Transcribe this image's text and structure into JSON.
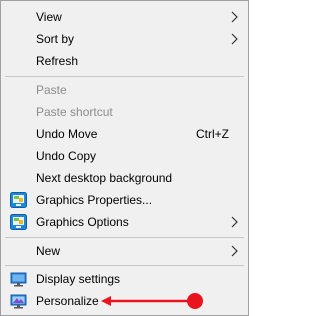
{
  "context_menu": {
    "view": {
      "label": "View",
      "icon": "chevron-right-icon"
    },
    "sort_by": {
      "label": "Sort by",
      "icon": "chevron-right-icon"
    },
    "refresh": {
      "label": "Refresh"
    },
    "paste": {
      "label": "Paste",
      "disabled": true
    },
    "paste_shortcut": {
      "label": "Paste shortcut",
      "disabled": true
    },
    "undo_move": {
      "label": "Undo Move",
      "shortcut": "Ctrl+Z"
    },
    "undo_copy": {
      "label": "Undo Copy"
    },
    "next_background": {
      "label": "Next desktop background"
    },
    "graphics_properties": {
      "label": "Graphics Properties...",
      "icon": "intel-graphics-icon"
    },
    "graphics_options": {
      "label": "Graphics Options",
      "icon": "intel-graphics-icon",
      "submenu_icon": "chevron-right-icon"
    },
    "new": {
      "label": "New",
      "icon": "chevron-right-icon"
    },
    "display_settings": {
      "label": "Display settings",
      "icon": "display-icon"
    },
    "personalize": {
      "label": "Personalize",
      "icon": "personalize-icon"
    }
  },
  "annotation": {
    "color": "#e8141e",
    "type": "red-arrow-pointer"
  }
}
